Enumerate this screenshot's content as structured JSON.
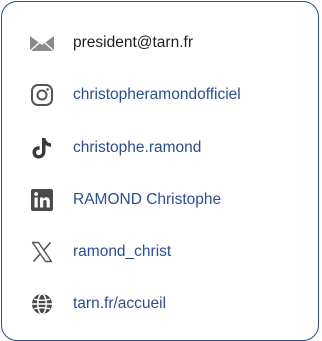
{
  "contacts": [
    {
      "icon": "envelope-icon",
      "label": "president@tarn.fr",
      "style": "dark"
    },
    {
      "icon": "instagram-icon",
      "label": "christopheramondofficiel",
      "style": "link"
    },
    {
      "icon": "tiktok-icon",
      "label": "christophe.ramond",
      "style": "link"
    },
    {
      "icon": "linkedin-icon",
      "label": "RAMOND Christophe",
      "style": "link"
    },
    {
      "icon": "x-icon",
      "label": "ramond_christ",
      "style": "link"
    },
    {
      "icon": "globe-icon",
      "label": "tarn.fr/accueil",
      "style": "link"
    }
  ],
  "colors": {
    "border": "#2f4a8c",
    "link": "#2a4d9b",
    "text": "#1f1f1f",
    "icon": "#555555"
  }
}
